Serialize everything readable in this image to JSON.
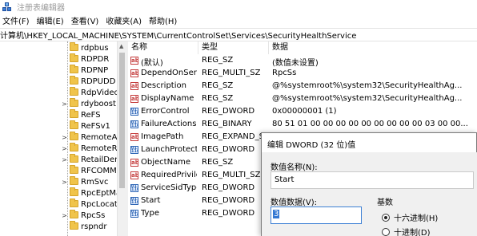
{
  "window": {
    "title": "注册表编辑器"
  },
  "menu": [
    {
      "label": "文件(F)"
    },
    {
      "label": "编辑(E)"
    },
    {
      "label": "查看(V)"
    },
    {
      "label": "收藏夹(A)"
    },
    {
      "label": "帮助(H)"
    }
  ],
  "address": {
    "path": "计算机\\HKEY_LOCAL_MACHINE\\SYSTEM\\CurrentControlSet\\Services\\SecurityHealthService"
  },
  "tree": {
    "items": [
      {
        "label": "rdpbus",
        "expander": ""
      },
      {
        "label": "RDPDR",
        "expander": ""
      },
      {
        "label": "RDPNP",
        "expander": ""
      },
      {
        "label": "RDPUDD",
        "expander": ""
      },
      {
        "label": "RdpVideo",
        "expander": ""
      },
      {
        "label": "rdyboost",
        "expander": ">"
      },
      {
        "label": "ReFS",
        "expander": ""
      },
      {
        "label": "ReFSv1",
        "expander": ""
      },
      {
        "label": "RemoteAc",
        "expander": ">"
      },
      {
        "label": "RemoteRe",
        "expander": ">"
      },
      {
        "label": "RetailDem",
        "expander": ">"
      },
      {
        "label": "RFCOMM",
        "expander": ""
      },
      {
        "label": "RmSvc",
        "expander": ">"
      },
      {
        "label": "RpcEptMa",
        "expander": ""
      },
      {
        "label": "RpcLocato",
        "expander": ""
      },
      {
        "label": "RpcSs",
        "expander": ">"
      },
      {
        "label": "rspndr",
        "expander": ""
      }
    ]
  },
  "values": {
    "headers": {
      "name": "名称",
      "type": "类型",
      "data": "数据"
    },
    "rows": [
      {
        "icon": "string-value-icon",
        "icon_text": "ab",
        "name": "(默认)",
        "type": "REG_SZ",
        "data": "(数值未设置)"
      },
      {
        "icon": "string-value-icon",
        "icon_text": "ab",
        "name": "DependOnSer...",
        "type": "REG_MULTI_SZ",
        "data": "RpcSs"
      },
      {
        "icon": "string-value-icon",
        "icon_text": "ab",
        "name": "Description",
        "type": "REG_SZ",
        "data": "@%systemroot%\\system32\\SecurityHealthAg..."
      },
      {
        "icon": "string-value-icon",
        "icon_text": "ab",
        "name": "DisplayName",
        "type": "REG_SZ",
        "data": "@%systemroot%\\system32\\SecurityHealthAg..."
      },
      {
        "icon": "binary-value-icon",
        "icon_text": "011 110",
        "name": "ErrorControl",
        "type": "REG_DWORD",
        "data": "0x00000001 (1)"
      },
      {
        "icon": "binary-value-icon",
        "icon_text": "011 110",
        "name": "FailureActions",
        "type": "REG_BINARY",
        "data": "80 51 01 00 00 00 00 00 00 00 00 00 03 00 00..."
      },
      {
        "icon": "string-value-icon",
        "icon_text": "ab",
        "name": "ImagePath",
        "type": "REG_EXPAND_SZ",
        "data": "%SystemRoot%\\system32\\SecurityHealthSer..."
      },
      {
        "icon": "binary-value-icon",
        "icon_text": "011 110",
        "name": "LaunchProtected",
        "type": "REG_DWORD",
        "data": ""
      },
      {
        "icon": "string-value-icon",
        "icon_text": "ab",
        "name": "ObjectName",
        "type": "REG_SZ",
        "data": ""
      },
      {
        "icon": "string-value-icon",
        "icon_text": "ab",
        "name": "RequiredPrivile...",
        "type": "REG_MULTI_SZ",
        "data": ""
      },
      {
        "icon": "binary-value-icon",
        "icon_text": "011 110",
        "name": "ServiceSidType",
        "type": "REG_DWORD",
        "data": ""
      },
      {
        "icon": "binary-value-icon",
        "icon_text": "011 110",
        "name": "Start",
        "type": "REG_DWORD",
        "data": ""
      },
      {
        "icon": "binary-value-icon",
        "icon_text": "011 110",
        "name": "Type",
        "type": "REG_DWORD",
        "data": ""
      }
    ]
  },
  "dialog": {
    "title": "编辑 DWORD (32 位)值",
    "name_label": "数值名称(N):",
    "name_value": "Start",
    "data_label": "数值数据(V):",
    "data_value": "3",
    "base_label": "基数",
    "radios": [
      {
        "label": "十六进制(H)",
        "checked": true
      },
      {
        "label": "十进制(D)",
        "checked": false
      }
    ]
  }
}
